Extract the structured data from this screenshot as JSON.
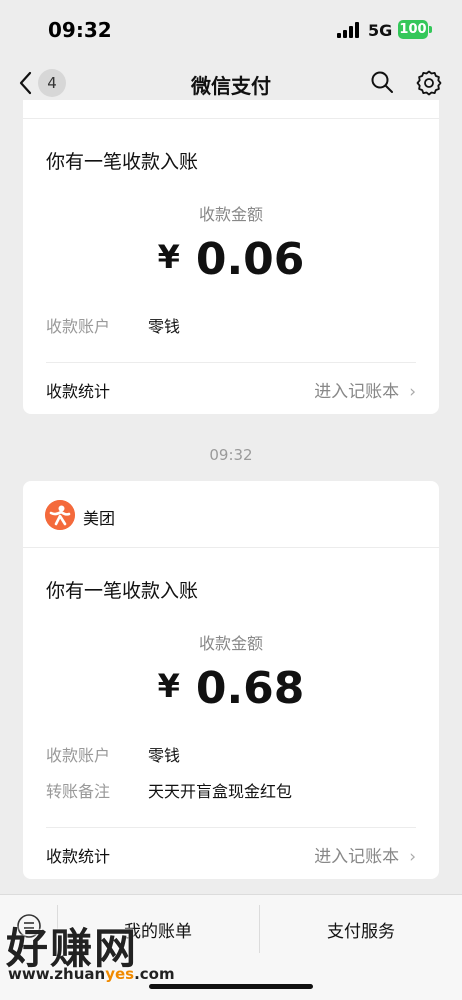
{
  "status": {
    "time": "09:32",
    "network": "5G",
    "battery": "100"
  },
  "nav": {
    "back_count": "4",
    "title": "微信支付"
  },
  "card1": {
    "message_title": "你有一笔收款入账",
    "amount_label": "收款金额",
    "currency": "¥",
    "amount": "0.06",
    "fields": [
      {
        "label": "收款账户",
        "value": "零钱"
      }
    ],
    "stat_label": "收款统计",
    "stat_link": "进入记账本",
    "chevron": "›"
  },
  "timestamp": "09:32",
  "card2": {
    "brand_name": "美团",
    "message_title": "你有一笔收款入账",
    "amount_label": "收款金额",
    "currency": "¥",
    "amount": "0.68",
    "fields": [
      {
        "label": "收款账户",
        "value": "零钱"
      },
      {
        "label": "转账备注",
        "value": "天天开盲盒现金红包"
      }
    ],
    "stat_label": "收款统计",
    "stat_link": "进入记账本",
    "chevron": "›"
  },
  "bottom_menu": {
    "left": "我的账单",
    "right": "支付服务"
  },
  "watermark": {
    "big": "好赚网",
    "small_pre": "www.zhuan",
    "small_hl": "yes",
    "small_post": ".com"
  },
  "colors": {
    "battery": "#34c759",
    "meituan": "#f46a3c",
    "background": "#ededed"
  },
  "icons": [
    "back-chevron-icon",
    "search-icon",
    "gear-icon",
    "meituan-logo-icon",
    "keyboard-menu-icon"
  ]
}
